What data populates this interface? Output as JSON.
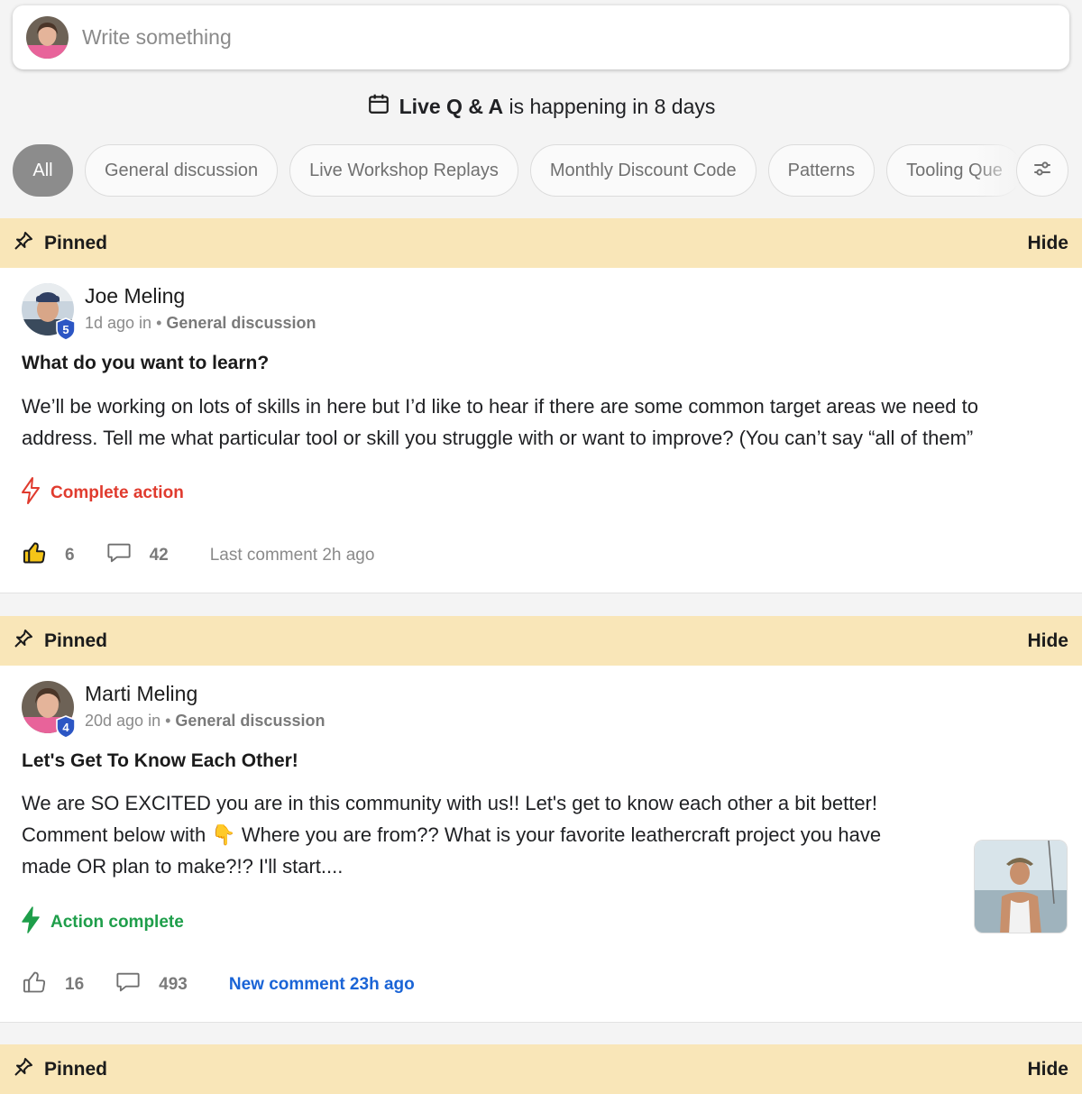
{
  "composer": {
    "placeholder": "Write something"
  },
  "live_banner": {
    "prefix": "Live Q & A",
    "suffix": "is happening in 8 days"
  },
  "chips": [
    "All",
    "General discussion",
    "Live Workshop Replays",
    "Monthly Discount Code",
    "Patterns",
    "Tooling Que"
  ],
  "active_chip": "All",
  "pinned_label": "Pinned",
  "hide_label": "Hide",
  "posts": [
    {
      "author": "Joe Meling",
      "level": "5",
      "time": "1d ago in",
      "category": "General discussion",
      "title": "What do you want to learn?",
      "body": "We’ll be working on lots of skills in here but I’d like to hear if there are some common target areas we need to address. Tell me what particular tool or skill you struggle with or want to improve? (You can’t say “all of them”",
      "action_label": "Complete action",
      "action_color": "#e03b2e",
      "likes": "6",
      "comments": "42",
      "last_comment": "Last comment 2h ago"
    },
    {
      "author": "Marti Meling",
      "level": "4",
      "time": "20d ago in",
      "category": "General discussion",
      "title": "Let's Get To Know Each Other!",
      "body_line1": "We are SO EXCITED you are in this community with us!! Let's get to know each other a bit better!",
      "body_line2a": "Comment below with",
      "body_line2b": "Where you are from?? What is your favorite leathercraft project you have",
      "body_line3": "made OR plan to make?!? I'll start....",
      "emoji": "👇",
      "action_label": "Action complete",
      "action_color": "#1e9e4a",
      "likes": "16",
      "comments": "493",
      "new_comment": "New comment 23h ago"
    }
  ],
  "icons": {
    "calendar": "calendar-icon",
    "pin": "pin-icon",
    "lightning": "lightning-icon",
    "like": "thumbs-up-icon",
    "comment": "comment-icon",
    "filter": "sliders-icon"
  }
}
